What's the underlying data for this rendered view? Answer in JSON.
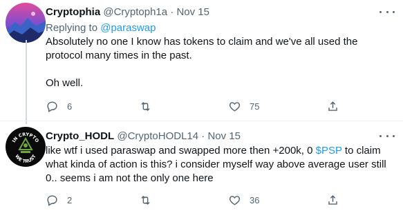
{
  "tweets": [
    {
      "name": "Cryptophia",
      "handle": "@Cryptoph1a",
      "separator": "·",
      "date": "Nov 15",
      "replying_prefix": "Replying to ",
      "replying_to": "@paraswap",
      "body_lines": [
        "Absolutely no one I know has tokens to claim and we've all used the protocol many times in the past.",
        "Oh well."
      ],
      "reply_count": "6",
      "retweet_count": "",
      "like_count": "75",
      "avatar_colors": {
        "sky_top": "#e24a9b",
        "sky_mid": "#7b4fd1",
        "mountains": "#1f2a6b",
        "peak": "#3b63c7"
      }
    },
    {
      "name": "Crypto_HODL",
      "handle": "@CryptoHODL14",
      "separator": "·",
      "date": "Nov 15",
      "body_pre": "like wtf i used paraswap and swapped more then +200k, 0 ",
      "body_link": "$PSP",
      "body_post": " to claim what kinda of action is this? i consider myself way above average user still 0.. seems i am not the only one here",
      "reply_count": "2",
      "retweet_count": "",
      "like_count": "36",
      "avatar_text_top": "IN CRYPTO",
      "avatar_text_bottom": "WE TRUST",
      "avatar_colors": {
        "bg": "#0a0a0a",
        "emblem": "#6ea83a"
      }
    }
  ],
  "colors": {
    "text": "#0f1419",
    "muted": "#536471",
    "accent": "#1d9bf0",
    "divider": "#eff3f4"
  },
  "icons": [
    "reply-icon",
    "retweet-icon",
    "like-icon",
    "share-icon",
    "more-icon"
  ]
}
